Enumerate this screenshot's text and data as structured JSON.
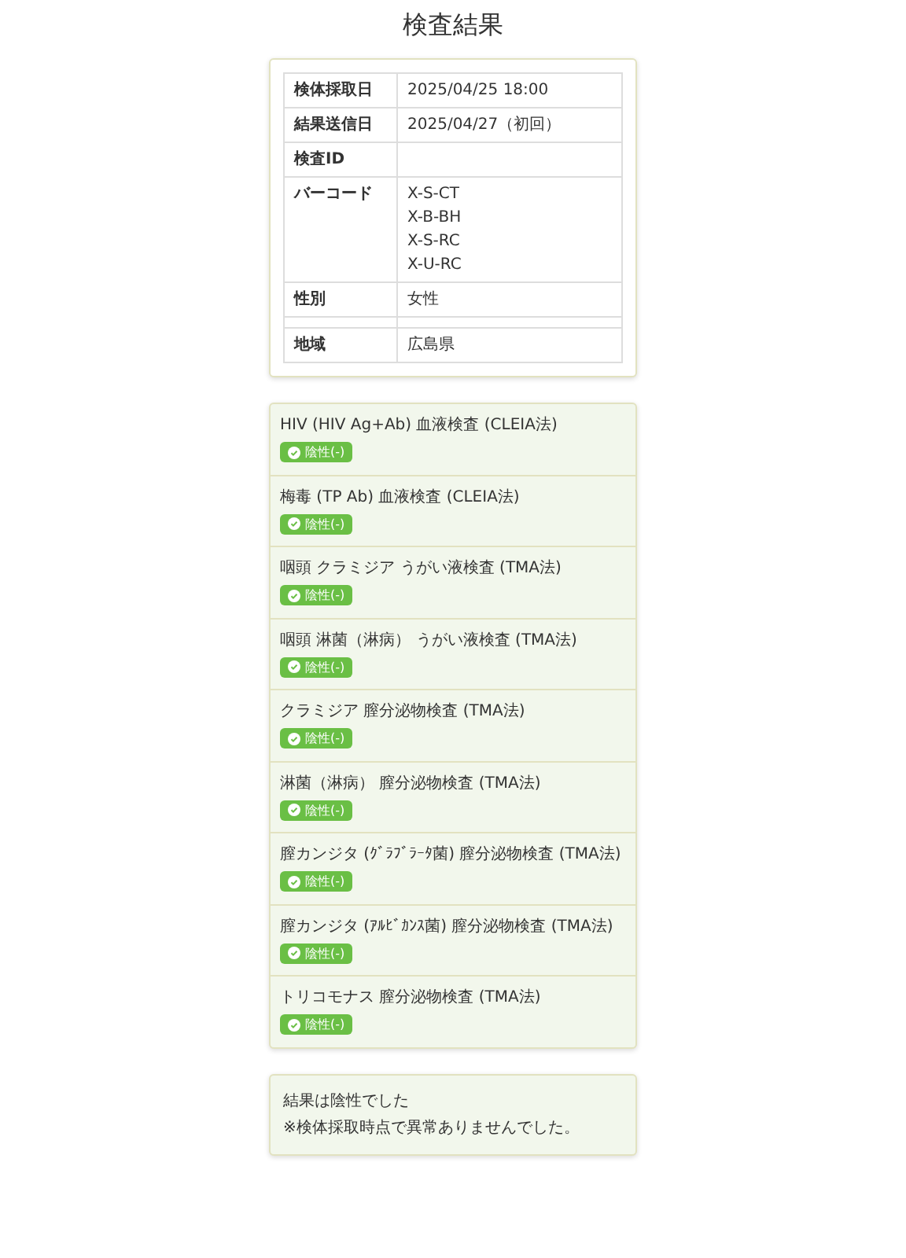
{
  "title": "検査結果",
  "info_rows": [
    {
      "label": "検体採取日",
      "values": [
        "2025/04/25 18:00"
      ]
    },
    {
      "label": "結果送信日",
      "values": [
        "2025/04/27（初回）"
      ]
    },
    {
      "label": "検査ID"
    },
    {
      "label": "バーコード",
      "values": [
        "X-S-CT",
        "X-B-BH",
        "X-S-RC",
        "X-U-RC"
      ]
    },
    {
      "label": "性別",
      "values": [
        "女性"
      ]
    },
    {},
    {
      "label": "地域",
      "values": [
        "広島県"
      ]
    }
  ],
  "tests": [
    {
      "name": "HIV (HIV Ag+Ab) 血液検査 (CLEIA法)",
      "result": {
        "label": "陰性(-)",
        "kind": "negative"
      }
    },
    {
      "name": "梅毒 (TP Ab) 血液検査 (CLEIA法)",
      "result": {
        "label": "陰性(-)",
        "kind": "negative"
      }
    },
    {
      "name": "咽頭 クラミジア うがい液検査 (TMA法)",
      "result": {
        "label": "陰性(-)",
        "kind": "negative"
      }
    },
    {
      "name": "咽頭 淋菌（淋病） うがい液検査 (TMA法)",
      "result": {
        "label": "陰性(-)",
        "kind": "negative"
      }
    },
    {
      "name": "クラミジア 膣分泌物検査 (TMA法)",
      "result": {
        "label": "陰性(-)",
        "kind": "negative"
      }
    },
    {
      "name": "淋菌（淋病） 膣分泌物検査 (TMA法)",
      "result": {
        "label": "陰性(-)",
        "kind": "negative"
      }
    },
    {
      "name": "膣カンジタ (ｸﾞﾗﾌﾞﾗｰﾀ菌) 膣分泌物検査 (TMA法)",
      "result": {
        "label": "陰性(-)",
        "kind": "negative"
      }
    },
    {
      "name": "膣カンジタ (ｱﾙﾋﾞｶﾝｽ菌) 膣分泌物検査 (TMA法)",
      "result": {
        "label": "陰性(-)",
        "kind": "negative"
      }
    },
    {
      "name": "トリコモナス 膣分泌物検査 (TMA法)",
      "result": {
        "label": "陰性(-)",
        "kind": "negative"
      }
    }
  ],
  "summary": [
    "結果は陰性でした",
    "※検体採取時点で異常ありませんでした。"
  ]
}
